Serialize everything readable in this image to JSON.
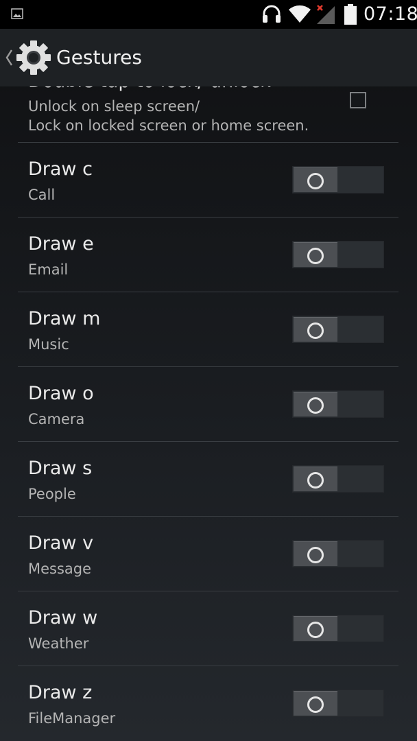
{
  "status_bar": {
    "time": "07:18",
    "icons": [
      "image-notification-icon",
      "headphones-icon",
      "wifi-icon",
      "signal-no-service-icon",
      "battery-icon"
    ]
  },
  "action_bar": {
    "title": "Gestures",
    "icon": "settings-gear-icon",
    "up_icon": "chevron-left-icon"
  },
  "settings": {
    "double_tap": {
      "title": "Double tap to lock/ unlock",
      "summary_line1": "Unlock on sleep screen/",
      "summary_line2": "Lock on locked screen or home screen.",
      "checked": false
    },
    "gestures": [
      {
        "title": "Draw c",
        "summary": "Call",
        "enabled": false
      },
      {
        "title": "Draw e",
        "summary": "Email",
        "enabled": false
      },
      {
        "title": "Draw m",
        "summary": "Music",
        "enabled": false
      },
      {
        "title": "Draw o",
        "summary": "Camera",
        "enabled": false
      },
      {
        "title": "Draw s",
        "summary": "People",
        "enabled": false
      },
      {
        "title": "Draw v",
        "summary": "Message",
        "enabled": false
      },
      {
        "title": "Draw w",
        "summary": "Weather",
        "enabled": false
      },
      {
        "title": "Draw z",
        "summary": "FileManager",
        "enabled": false
      }
    ]
  },
  "colors": {
    "background": "#1a1d21",
    "text_primary": "#eaeaea",
    "text_secondary": "#b4b4b4",
    "switch_off_track": "#2b2f33",
    "switch_thumb": "#4c4f53"
  }
}
